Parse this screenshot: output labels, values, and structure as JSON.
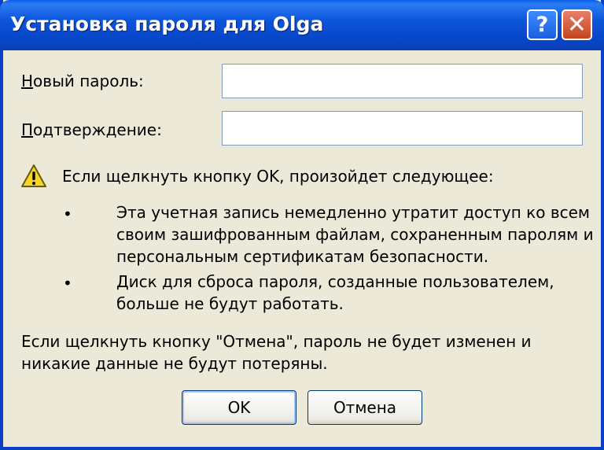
{
  "window": {
    "title": "Установка пароля для Olga",
    "help_label": "?",
    "close_label": "✕"
  },
  "form": {
    "new_password_accel": "Н",
    "new_password_rest": "овый пароль:",
    "new_password_value": "",
    "confirm_accel": "П",
    "confirm_rest": "одтверждение:",
    "confirm_value": ""
  },
  "warning": {
    "icon": "warning-icon",
    "heading": "Если щелкнуть кнопку OK, произойдет следующее:",
    "bullets": [
      "Эта учетная запись немедленно утратит доступ ко всем своим зашифрованным файлам, сохраненным паролям и персональным сертификатам безопасности.",
      "Диск для сброса пароля, созданные пользователем, больше не будут работать."
    ],
    "bullet_mark": "•",
    "footer": "Если щелкнуть кнопку \"Отмена\", пароль не будет изменен и никакие данные не будут потеряны."
  },
  "buttons": {
    "ok_label": "OK",
    "cancel_label": "Отмена"
  },
  "colors": {
    "titlebar": "#0a5fe8",
    "dialog_bg": "#ece9d8",
    "close": "#c5431d"
  }
}
